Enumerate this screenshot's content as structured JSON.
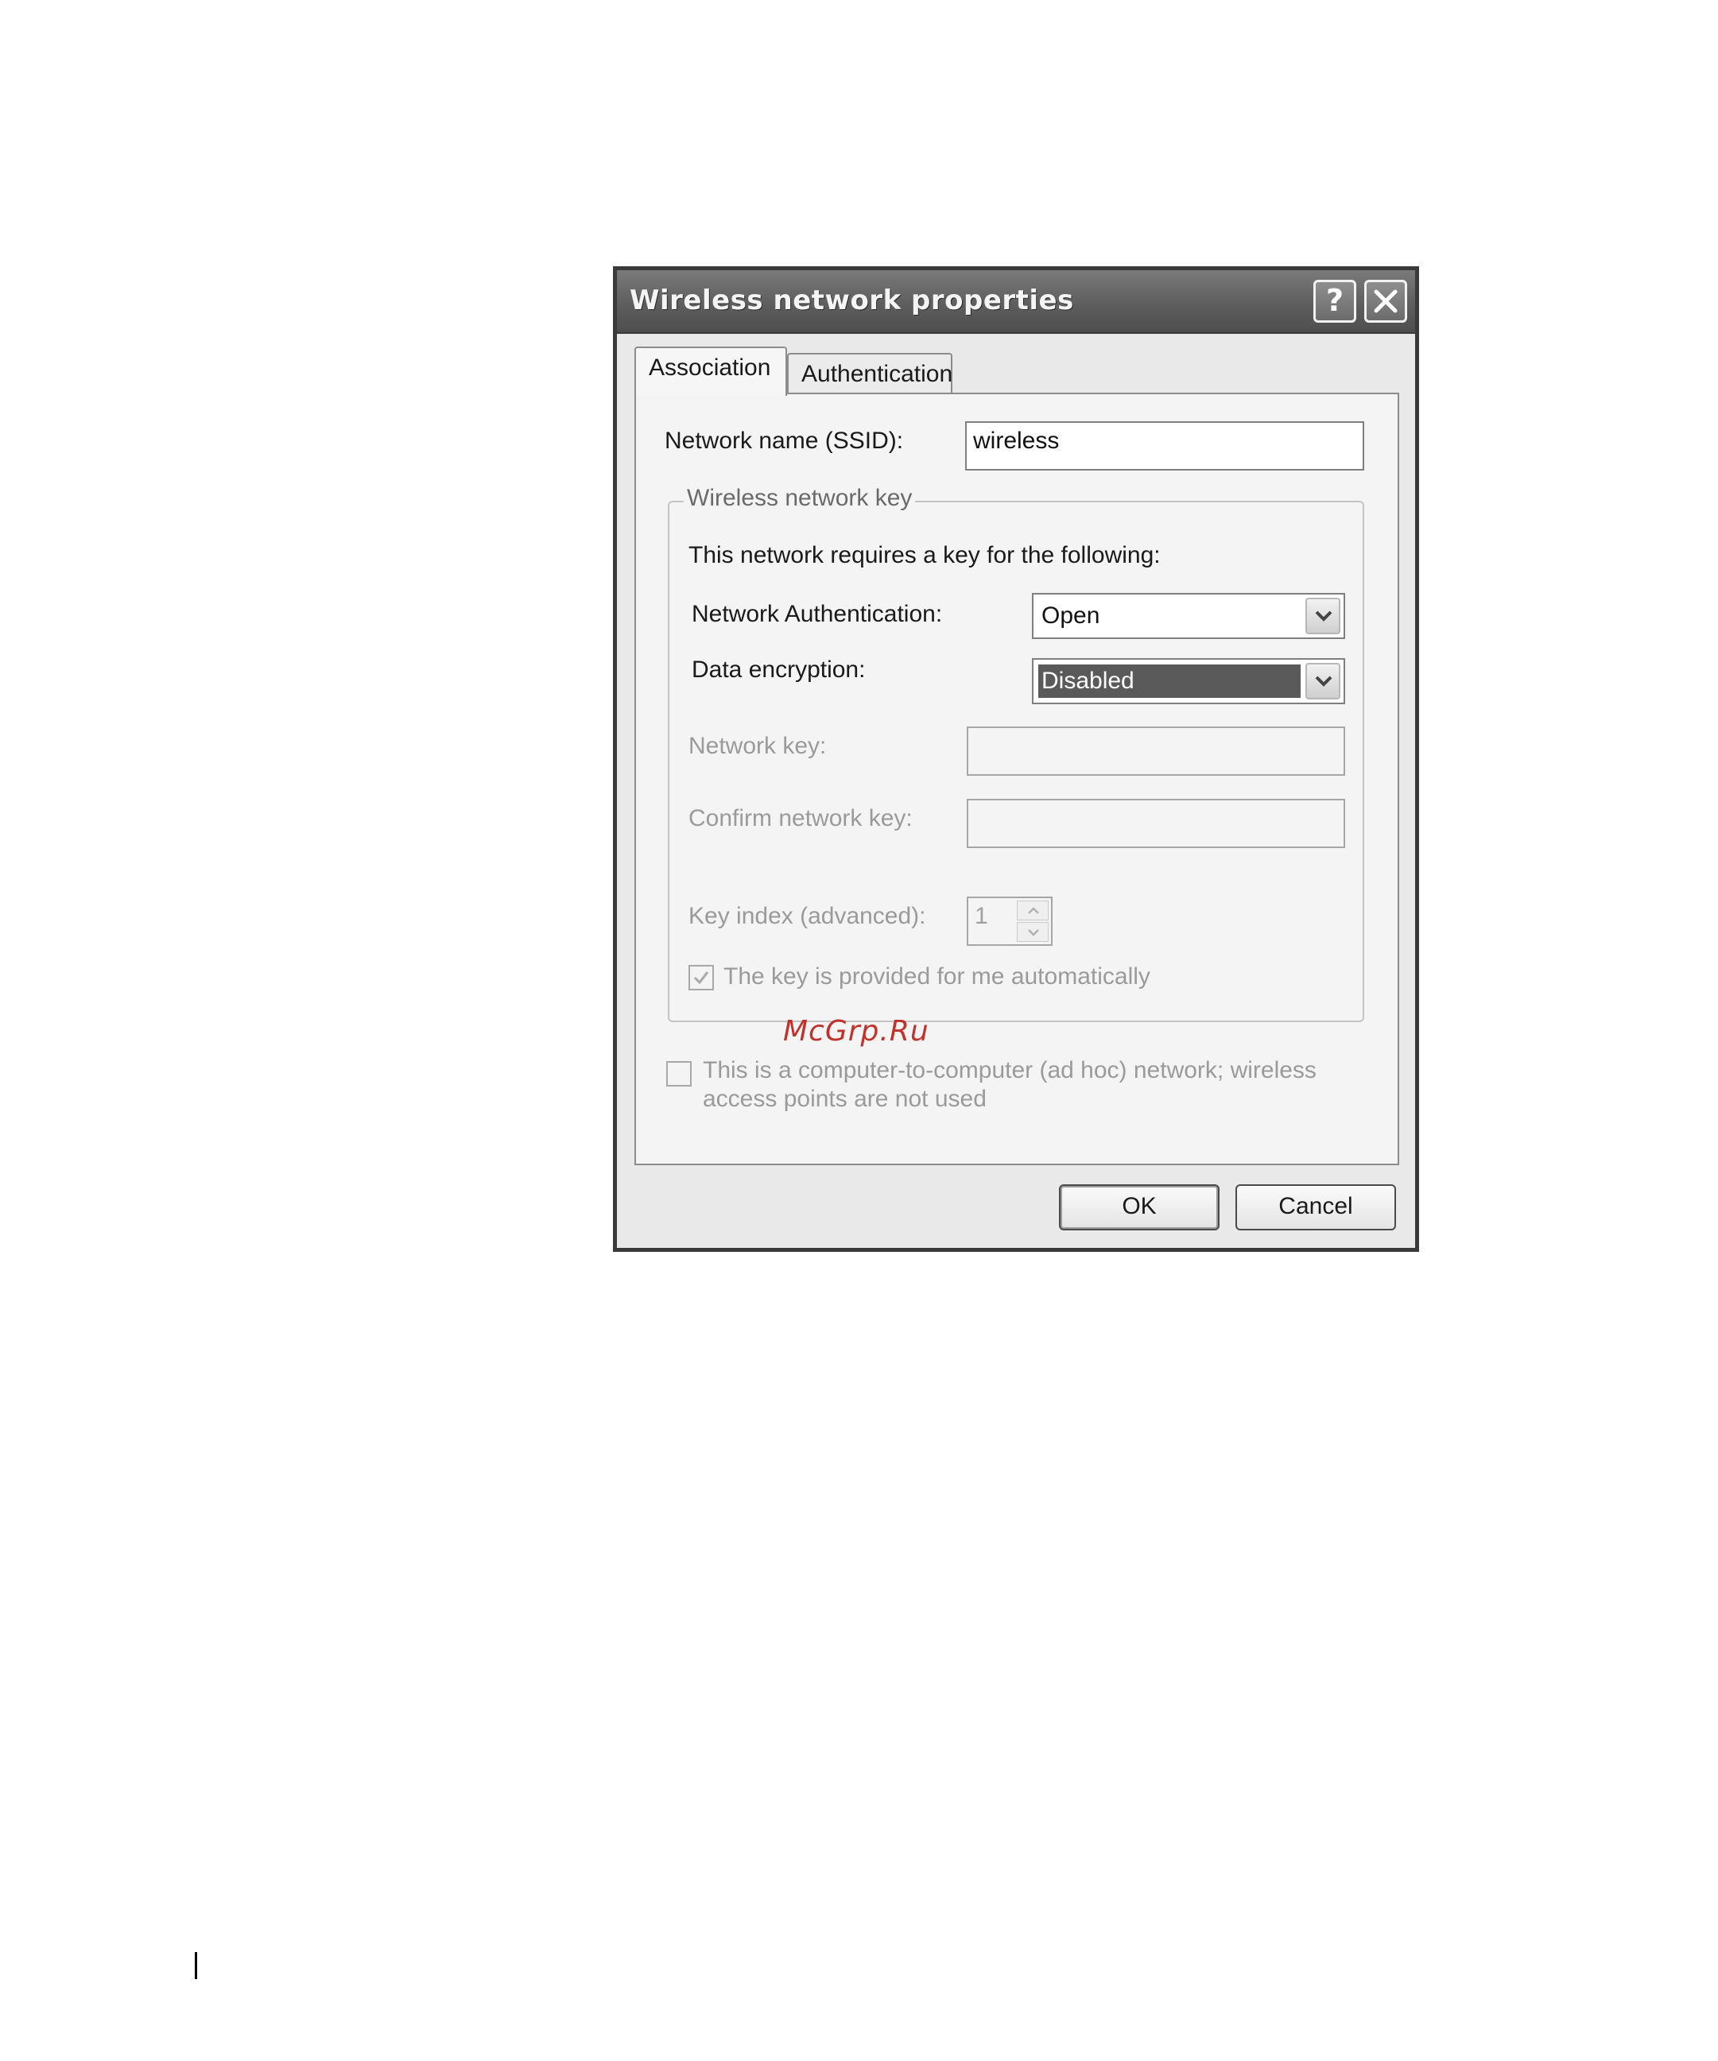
{
  "dialog": {
    "title": "Wireless network properties",
    "help_label": "?",
    "tabs": [
      {
        "label": "Association",
        "active": true
      },
      {
        "label": "Authentication",
        "active": false
      }
    ]
  },
  "association": {
    "ssid_label": "Network name (SSID):",
    "ssid_value": "wireless",
    "key_group": {
      "legend": "Wireless network key",
      "intro": "This network requires a key for the following:",
      "auth_label": "Network Authentication:",
      "auth_value": "Open",
      "encryption_label": "Data encryption:",
      "encryption_value": "Disabled",
      "network_key_label": "Network key:",
      "network_key_value": "",
      "confirm_key_label": "Confirm network key:",
      "confirm_key_value": "",
      "key_index_label": "Key index (advanced):",
      "key_index_value": "1",
      "auto_key_label": "The key is provided for me automatically",
      "auto_key_checked": true
    },
    "adhoc_label_line1": "This is a computer-to-computer (ad hoc) network; wireless",
    "adhoc_label_line2": "access points are not used",
    "adhoc_checked": false
  },
  "buttons": {
    "ok_label": "OK",
    "cancel_label": "Cancel"
  },
  "watermark": "McGrp.Ru"
}
